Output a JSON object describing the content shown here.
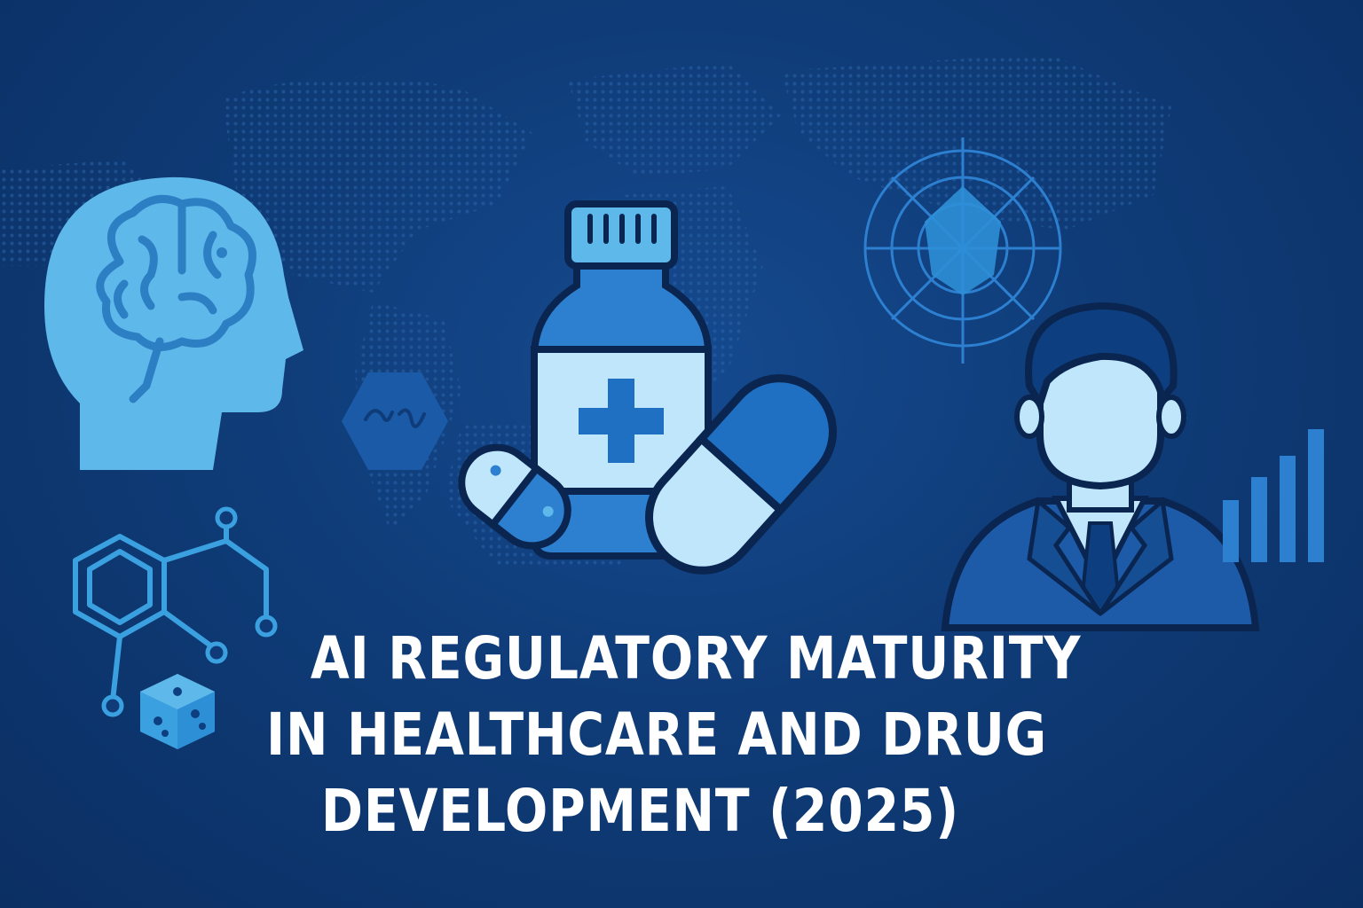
{
  "title": {
    "line1": "AI REGULATORY MATURITY",
    "line2": "IN HEALTHCARE AND DRUG",
    "line3": "DEVELOPMENT (2025)"
  },
  "colors": {
    "background": "#0f3c78",
    "accent_light": "#5fb8ea",
    "accent_mid": "#2d8fd6",
    "accent_dark": "#0d3f80",
    "outline": "#0a2550",
    "text": "#ffffff"
  },
  "icons": [
    "head-brain-icon",
    "molecule-icon",
    "dice-icon",
    "hexagon-icon",
    "medicine-bottle-icon",
    "capsule-icon",
    "radar-icon",
    "businessman-icon",
    "bar-chart-icon"
  ]
}
